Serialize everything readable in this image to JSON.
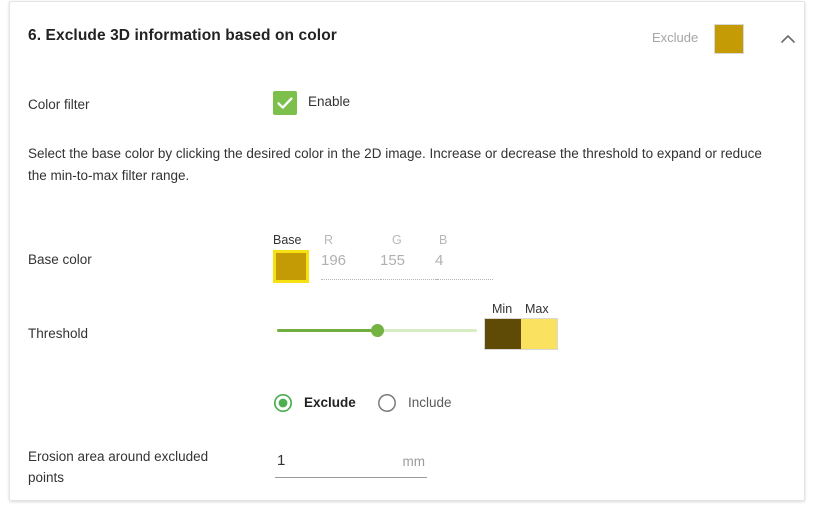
{
  "header": {
    "title": "6. Exclude 3D information based on color",
    "mode_label": "Exclude",
    "swatch_color": "#c49b04",
    "collapse_icon": "chevron-up-icon"
  },
  "color_filter": {
    "label": "Color filter",
    "enable_label": "Enable",
    "enabled": true,
    "checkbox_color": "#7cc04b",
    "check_icon": "check-icon"
  },
  "description": "Select the base color by clicking the desired color in the 2D image. Increase or decrease the threshold to expand or reduce the min-to-max filter range.",
  "base_color": {
    "label": "Base color",
    "swatch_header": "Base",
    "swatch_color": "#c49b04",
    "swatch_border_color": "#f5e012",
    "channels": [
      {
        "header": "R",
        "value": "196"
      },
      {
        "header": "G",
        "value": "155"
      },
      {
        "header": "B",
        "value": "4"
      }
    ]
  },
  "threshold": {
    "label": "Threshold",
    "slider_percent": 50,
    "track_color": "#d8ecc4",
    "fill_color": "#6fae3f",
    "thumb_color": "#72b342",
    "min_header": "Min",
    "max_header": "Max",
    "min_color": "#5f4a06",
    "max_color": "#fae15f"
  },
  "filter_mode": {
    "selected": "Exclude",
    "options": [
      {
        "label": "Exclude",
        "selected": true
      },
      {
        "label": "Include",
        "selected": false
      }
    ],
    "accent_color": "#4caf50"
  },
  "erosion": {
    "label": "Erosion area around excluded points",
    "value": "1",
    "unit": "mm"
  }
}
